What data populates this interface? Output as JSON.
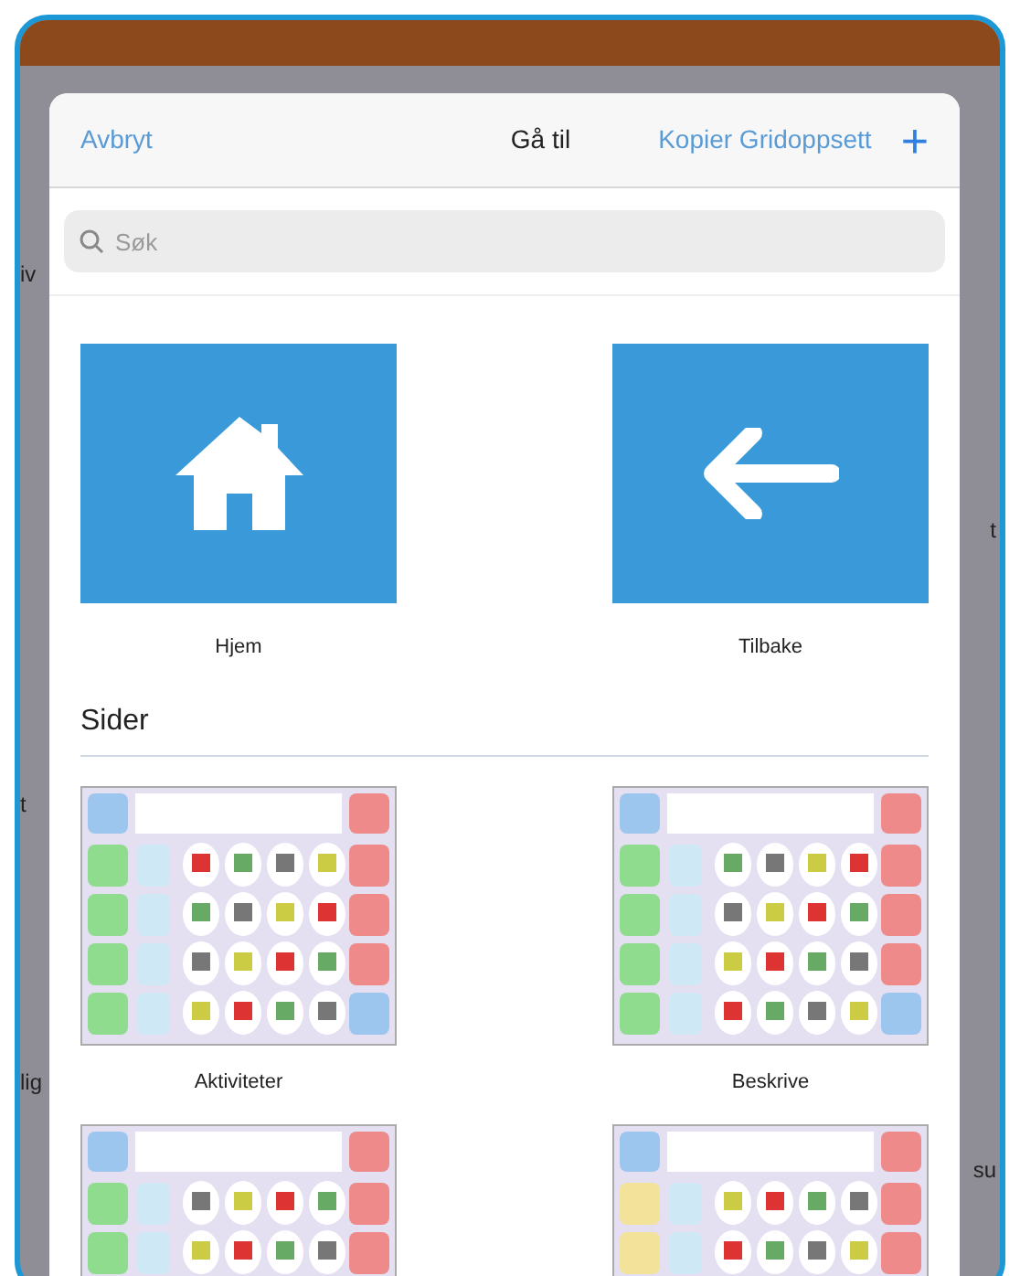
{
  "background": {
    "left_fragments": [
      "iv",
      "t",
      "lig"
    ],
    "right_fragments": [
      "t",
      "su"
    ]
  },
  "dialog": {
    "cancel": "Avbryt",
    "title": "Gå til",
    "copy": "Kopier Gridoppsett",
    "add": "+"
  },
  "search": {
    "placeholder": "Søk"
  },
  "shortcuts": [
    {
      "kind": "home",
      "label": "Hjem"
    },
    {
      "kind": "back",
      "label": "Tilbake"
    }
  ],
  "section_title": "Sider",
  "pages": [
    {
      "kind": "thumbnail",
      "label": "Aktiviteter"
    },
    {
      "kind": "thumbnail",
      "label": "Beskrive"
    },
    {
      "kind": "thumbnail"
    },
    {
      "kind": "thumbnail"
    }
  ]
}
